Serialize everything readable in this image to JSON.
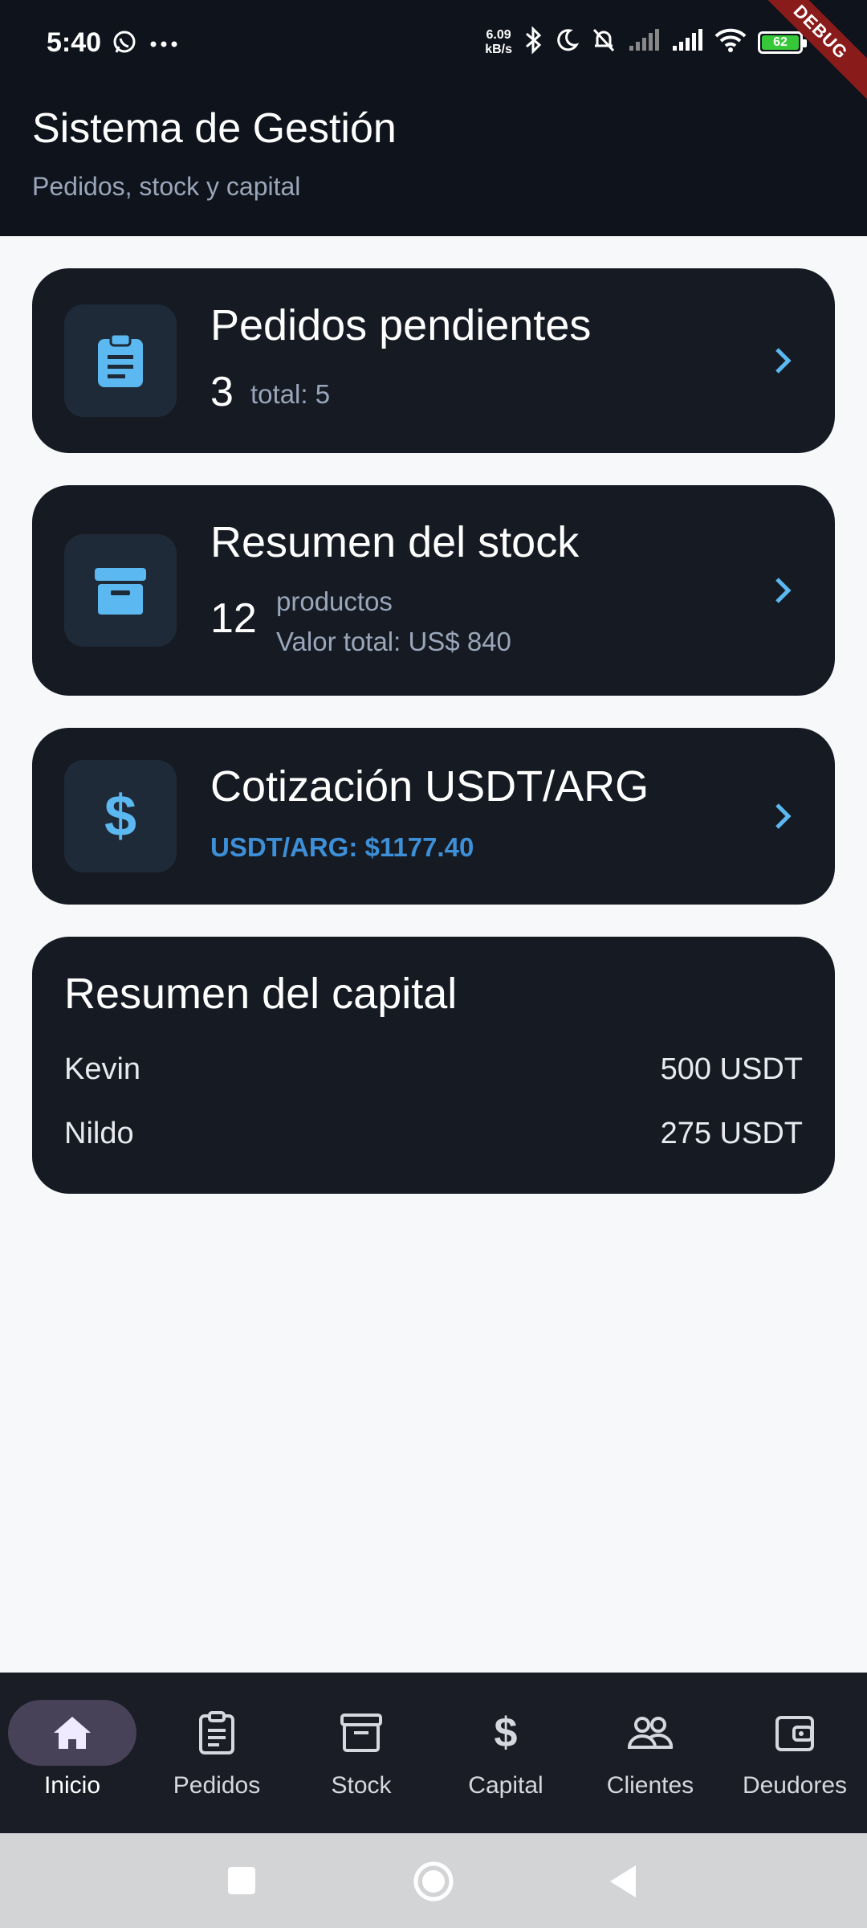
{
  "status_bar": {
    "time": "5:40",
    "net_speed_value": "6.09",
    "net_speed_unit": "kB/s",
    "battery_level": "62",
    "debug_label": "DEBUG",
    "icons": [
      "whatsapp-icon",
      "more-icon",
      "bluetooth-icon",
      "moon-icon",
      "bell-off-icon",
      "signal-icon",
      "signal-icon",
      "wifi-icon",
      "battery-icon"
    ]
  },
  "header": {
    "title": "Sistema de Gestión",
    "subtitle": "Pedidos, stock y capital"
  },
  "cards": {
    "pedidos": {
      "title": "Pedidos pendientes",
      "count": "3",
      "total": "total: 5",
      "icon": "clipboard-icon"
    },
    "stock": {
      "title": "Resumen del stock",
      "count": "12",
      "unit": "productos",
      "value": "Valor total: US$ 840",
      "icon": "archive-box-icon"
    },
    "cotizacion": {
      "title": "Cotización USDT/ARG",
      "rate": "USDT/ARG: $1177.40",
      "icon": "dollar-icon"
    }
  },
  "capital": {
    "title": "Resumen del capital",
    "rows": [
      {
        "name": "Kevin",
        "amount": "500 USDT"
      },
      {
        "name": "Nildo",
        "amount": "275 USDT"
      }
    ]
  },
  "bottom_nav": {
    "items": [
      {
        "label": "Inicio",
        "icon": "home-icon",
        "active": true
      },
      {
        "label": "Pedidos",
        "icon": "clipboard-icon",
        "active": false
      },
      {
        "label": "Stock",
        "icon": "archive-box-icon",
        "active": false
      },
      {
        "label": "Capital",
        "icon": "dollar-icon",
        "active": false
      },
      {
        "label": "Clientes",
        "icon": "people-icon",
        "active": false
      },
      {
        "label": "Deudores",
        "icon": "wallet-icon",
        "active": false
      }
    ]
  },
  "colors": {
    "header_bg": "#0f131b",
    "card_bg": "#161b23",
    "accent_blue": "#5bb8f0",
    "rate_blue": "#3d8fd8",
    "page_bg": "#f7f8fa",
    "nav_bg": "#1a1d25",
    "nav_active_pill": "#474258"
  }
}
